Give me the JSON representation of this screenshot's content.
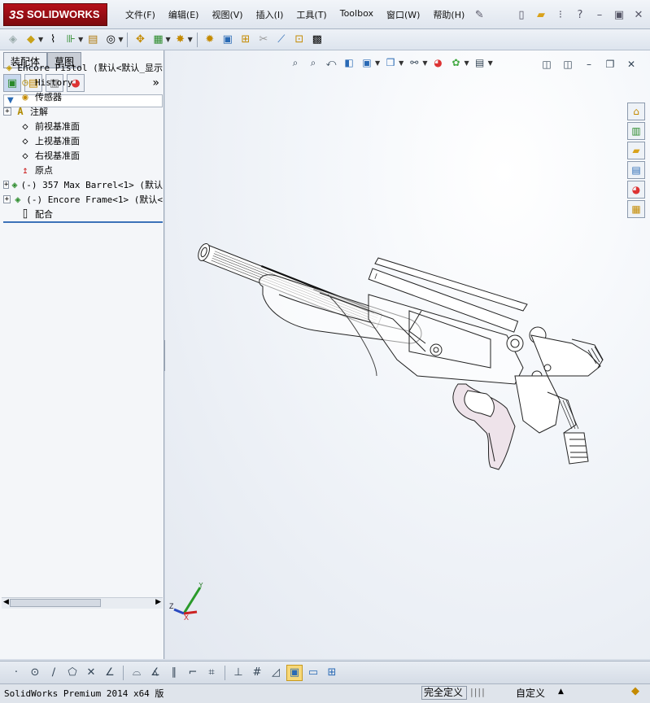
{
  "app": {
    "logo_prefix": "3S",
    "logo_text": "SOLIDWORKS"
  },
  "menu": [
    {
      "label": "文件(F)"
    },
    {
      "label": "编辑(E)"
    },
    {
      "label": "视图(V)"
    },
    {
      "label": "插入(I)"
    },
    {
      "label": "工具(T)"
    },
    {
      "label": "Toolbox"
    },
    {
      "label": "窗口(W)"
    },
    {
      "label": "帮助(H)"
    }
  ],
  "panel": {
    "tabs": [
      "装配体",
      "草图"
    ],
    "active_tab": "装配体",
    "expand_glyph": "»"
  },
  "tree": [
    {
      "label": "Encore Pistol  (默认<默认_显示",
      "icon": "assembly-icon",
      "expandable": false,
      "indent": 0
    },
    {
      "label": "History",
      "icon": "history-icon",
      "expandable": false,
      "indent": 1
    },
    {
      "label": "传感器",
      "icon": "sensor-icon",
      "expandable": false,
      "indent": 1
    },
    {
      "label": "注解",
      "icon": "annotation-icon",
      "expandable": true,
      "indent": 1
    },
    {
      "label": "前视基准面",
      "icon": "plane-icon",
      "expandable": false,
      "indent": 1
    },
    {
      "label": "上视基准面",
      "icon": "plane-icon",
      "expandable": false,
      "indent": 1
    },
    {
      "label": "右视基准面",
      "icon": "plane-icon",
      "expandable": false,
      "indent": 1
    },
    {
      "label": "原点",
      "icon": "origin-icon",
      "expandable": false,
      "indent": 1
    },
    {
      "label": "(-) 357 Max Barrel<1> (默认",
      "icon": "part-icon",
      "expandable": true,
      "indent": 1
    },
    {
      "label": "(-) Encore Frame<1> (默认<",
      "icon": "part-icon",
      "expandable": true,
      "indent": 1
    },
    {
      "label": "配合",
      "icon": "mates-icon",
      "expandable": false,
      "indent": 1
    }
  ],
  "triad": {
    "x": "X",
    "y": "Y",
    "z": "Z"
  },
  "status": {
    "app_version": "SolidWorks Premium 2014 x64 版",
    "definition": "完全定义",
    "custom": "自定义"
  }
}
